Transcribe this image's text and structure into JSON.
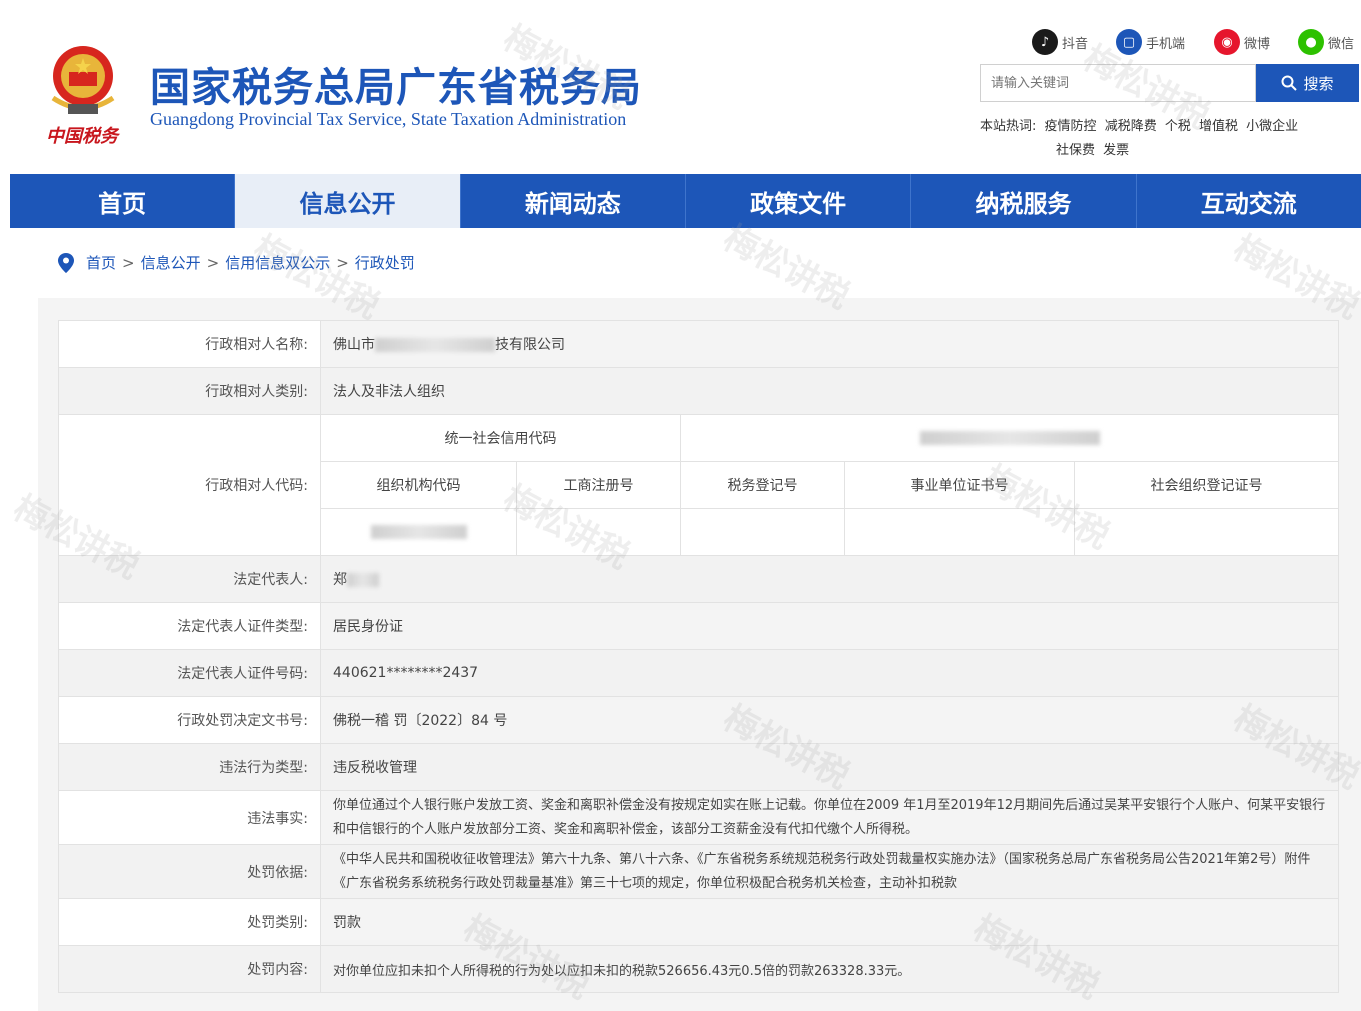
{
  "header": {
    "title": "国家税务总局广东省税务局",
    "subtitle": "Guangdong Provincial Tax Service, State Taxation Administration",
    "seal_text": "中国税务",
    "social": [
      {
        "label": "抖音",
        "icon": "douyin-icon",
        "color": "#1a1a1a"
      },
      {
        "label": "手机端",
        "icon": "mobile-icon",
        "color": "#1d56b8"
      },
      {
        "label": "微博",
        "icon": "weibo-icon",
        "color": "#e6162d"
      },
      {
        "label": "微信",
        "icon": "wechat-icon",
        "color": "#2dc100"
      }
    ],
    "search_placeholder": "请输入关键词",
    "search_label": "搜索",
    "hot_label": "本站热词:",
    "hot_words": [
      "疫情防控",
      "减税降费",
      "个税",
      "增值税",
      "小微企业",
      "社保费",
      "发票"
    ]
  },
  "nav": {
    "items": [
      "首页",
      "信息公开",
      "新闻动态",
      "政策文件",
      "纳税服务",
      "互动交流"
    ],
    "active_index": 1
  },
  "breadcrumb": [
    "首页",
    "信息公开",
    "信用信息双公示",
    "行政处罚"
  ],
  "record": {
    "name_label": "行政相对人名称:",
    "name_value_prefix": "佛山市",
    "name_value_suffix": "技有限公司",
    "type_label": "行政相对人类别:",
    "type_value": "法人及非法人组织",
    "code_label": "行政相对人代码:",
    "code_headers": {
      "uscc": "统一社会信用代码",
      "org_code": "组织机构代码",
      "biz_reg": "工商注册号",
      "tax_reg": "税务登记号",
      "inst_cert": "事业单位证书号",
      "social_org": "社会组织登记证号"
    },
    "legal_rep_label": "法定代表人:",
    "legal_rep_value": "郑",
    "id_type_label": "法定代表人证件类型:",
    "id_type_value": "居民身份证",
    "id_no_label": "法定代表人证件号码:",
    "id_no_value": "440621********2437",
    "doc_no_label": "行政处罚决定文书号:",
    "doc_no_value": "佛税一稽 罚〔2022〕84 号",
    "violation_type_label": "违法行为类型:",
    "violation_type_value": "违反税收管理",
    "facts_label": "违法事实:",
    "facts_value": "你单位通过个人银行账户发放工资、奖金和离职补偿金没有按规定如实在账上记载。你单位在2009 年1月至2019年12月期间先后通过吴某平安银行个人账户、何某平安银行和中信银行的个人账户发放部分工资、奖金和离职补偿金，该部分工资薪金没有代扣代缴个人所得税。",
    "basis_label": "处罚依据:",
    "basis_value": "《中华人民共和国税收征收管理法》第六十九条、第八十六条、《广东省税务系统规范税务行政处罚裁量权实施办法》（国家税务总局广东省税务局公告2021年第2号）附件《广东省税务系统税务行政处罚裁量基准》第三十七项的规定，你单位积极配合税务机关检查，主动补扣税款",
    "category_label": "处罚类别:",
    "category_value": "罚款",
    "content_label": "处罚内容:",
    "content_value": "对你单位应扣未扣个人所得税的行为处以应扣未扣的税款526656.43元0.5倍的罚款263328.33元。"
  },
  "watermark": "梅松讲税"
}
